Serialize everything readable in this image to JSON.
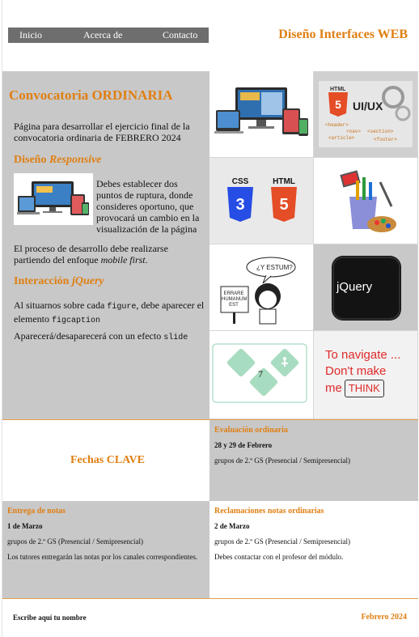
{
  "nav": {
    "items": [
      {
        "label": "Inicio"
      },
      {
        "label": "Acerca de"
      },
      {
        "label": "Contacto"
      }
    ]
  },
  "header": {
    "title": "Diseño Interfaces WEB"
  },
  "main": {
    "title": "Convocatoria ORDINARIA",
    "intro": "Página para desarrollar el ejercicio final de la convocatoria ordinaria de FEBRERO 2024",
    "responsive": {
      "heading_plain": "Diseño ",
      "heading_italic": "Responsive",
      "text": "Debes establecer dos puntos de ruptura, donde consideres oportuno, que provocará un cambio en la visualización de la página",
      "process_text": "El proceso de desarrollo debe realizarse partiendo del enfoque ",
      "process_italic": "mobile first",
      "process_end": "."
    },
    "jquery": {
      "heading_plain": "Interacción ",
      "heading_italic": "jQuery",
      "p1_a": "Al situarnos sobre cada ",
      "p1_code1": "figure",
      "p1_b": ", debe aparecer el elemento ",
      "p1_code2": "figcaption",
      "p2_a": "Aparecerá/desaparecerá con un efecto ",
      "p2_code": "slide"
    }
  },
  "gallery": {
    "html_uiux_a": "HTML",
    "html_uiux_b": "UI/UX",
    "tags": [
      "<header>",
      "<nav>",
      "<section>",
      "<article>",
      "<footer>"
    ],
    "css_label": "CSS",
    "html_label": "HTML",
    "bubble": "¿Y ESTUM?",
    "sign": "ERRARE HUMANUM EST",
    "jquery_logo": "jQuery",
    "number_badge": "7",
    "navigate_line1": "To navigate ...",
    "navigate_line2": "Don't make",
    "navigate_line3a": "me",
    "navigate_line3b": "THINK"
  },
  "dates": {
    "title": "Fechas CLAVE",
    "evaluation": {
      "title": "Evaluación ordinaria",
      "date": "28 y 29 de Febrero",
      "group": "grupos de 2.º GS (Presencial / Semipresencial)"
    },
    "grades": {
      "title": "Entrega de notas",
      "date": "1 de Marzo",
      "group": "grupos de 2.º GS (Presencial / Semipresencial)",
      "note": "Los tutores entregarán las notas por los canales correspondientes."
    },
    "claims": {
      "title": "Reclamaciones notas ordinarias",
      "date": "2 de Marzo",
      "group": "grupos de 2.º GS (Presencial / Semipresencial)",
      "note": "Debes contactar con el profesor del módulo."
    }
  },
  "footer": {
    "name": "Escribe aquí tu nombre",
    "date": "Febrero 2024"
  },
  "colors": {
    "accent": "#e07f12",
    "panel": "#c8c8c8",
    "nav": "#6e6e6e"
  }
}
